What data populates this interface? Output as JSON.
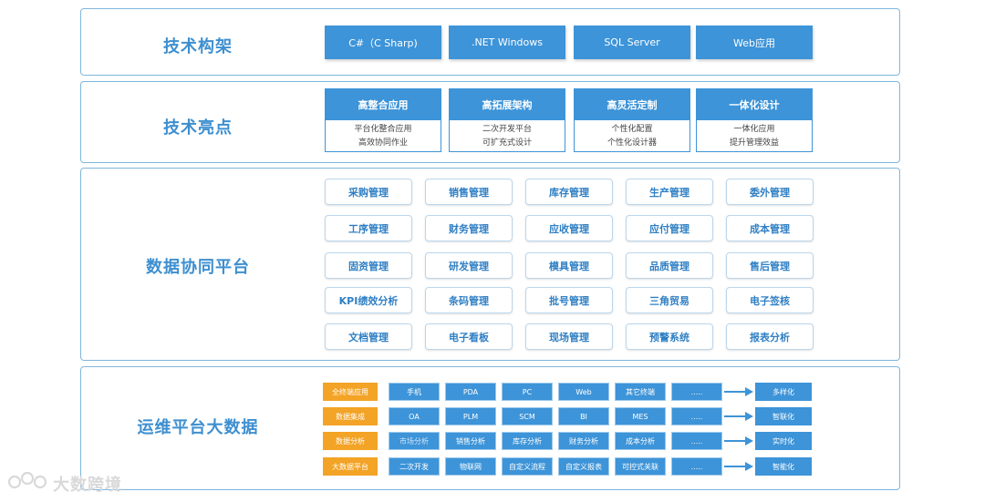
{
  "architecture": {
    "title": "技术构架",
    "items": [
      "C#（C Sharp)",
      ".NET Windows",
      "SQL Server",
      "Web应用"
    ]
  },
  "highlights": {
    "title": "技术亮点",
    "cards": [
      {
        "head": "高整合应用",
        "lines": [
          "平台化整合应用",
          "高效协同作业"
        ]
      },
      {
        "head": "高拓展架构",
        "lines": [
          "二次开发平台",
          "可扩充式设计"
        ]
      },
      {
        "head": "高灵活定制",
        "lines": [
          "个性化配置",
          "个性化设计器"
        ]
      },
      {
        "head": "一体化设计",
        "lines": [
          "一体化应用",
          "提升管理效益"
        ]
      }
    ]
  },
  "collab": {
    "title": "数据协同平台",
    "rows": [
      [
        "采购管理",
        "销售管理",
        "库存管理",
        "生产管理",
        "委外管理"
      ],
      [
        "工序管理",
        "财务管理",
        "应收管理",
        "应付管理",
        "成本管理"
      ],
      [
        "固资管理",
        "研发管理",
        "模具管理",
        "品质管理",
        "售后管理"
      ],
      [
        "KPI绩效分析",
        "条码管理",
        "批号管理",
        "三角贸易",
        "电子签核"
      ],
      [
        "文档管理",
        "电子看板",
        "现场管理",
        "预警系统",
        "报表分析"
      ]
    ]
  },
  "ops": {
    "title": "运维平台大数据",
    "rows": [
      {
        "label": "全终端应用",
        "cells": [
          "手机",
          "PDA",
          "PC",
          "Web",
          "其它终端",
          "....."
        ],
        "result": "多样化"
      },
      {
        "label": "数据集成",
        "cells": [
          "OA",
          "PLM",
          "SCM",
          "BI",
          "MES",
          "....."
        ],
        "result": "智联化"
      },
      {
        "label": "数据分析",
        "cells": [
          "市场分析",
          "销售分析",
          "库存分析",
          "财务分析",
          "成本分析",
          "....."
        ],
        "result": "实时化"
      },
      {
        "label": "大数据平台",
        "cells": [
          "二次开发",
          "物联网",
          "自定义流程",
          "自定义报表",
          "可控式关联",
          "....."
        ],
        "result": "智能化"
      }
    ]
  },
  "watermark": {
    "text": "大数跨境"
  },
  "colors": {
    "primary": "#3d94d8",
    "accent": "#f3a325",
    "border": "#7fb6dc",
    "title": "#3d8fd0"
  }
}
